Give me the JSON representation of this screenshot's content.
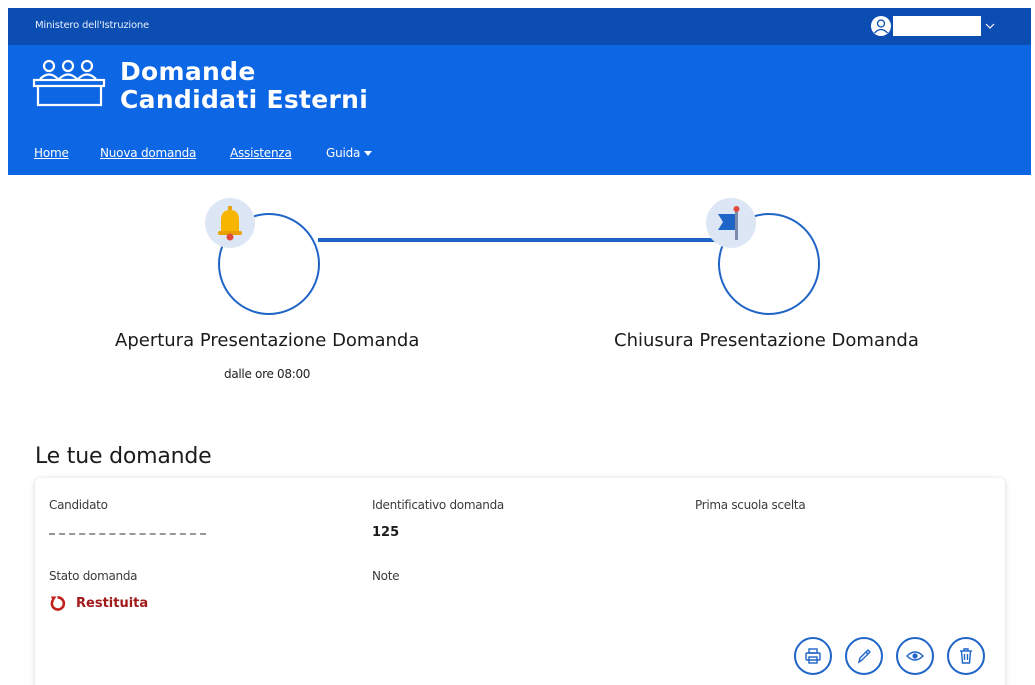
{
  "header": {
    "ministry": "Ministero dell'Istruzione",
    "brand_line1": "Domande",
    "brand_line2": "Candidati Esterni"
  },
  "nav": {
    "items": [
      {
        "label": "Home"
      },
      {
        "label": "Nuova domanda"
      },
      {
        "label": "Assistenza"
      },
      {
        "label": "Guida"
      }
    ]
  },
  "timeline": {
    "opening_title": "Apertura Presentazione Domanda",
    "opening_sub": "dalle ore 08:00",
    "closing_title": "Chiusura Presentazione Domanda"
  },
  "applications": {
    "section_title": "Le tue domande",
    "labels": {
      "candidate": "Candidato",
      "id": "Identificativo domanda",
      "school": "Prima scuola scelta",
      "status": "Stato domanda",
      "notes": "Note"
    },
    "id_value": "125",
    "status_value": "Restituita",
    "actions": [
      "print",
      "edit",
      "view",
      "delete"
    ]
  },
  "colors": {
    "topbar": "#0b4db0",
    "brand": "#0d66e4",
    "accent": "#1f64c7",
    "status_red": "#a11a1a"
  }
}
